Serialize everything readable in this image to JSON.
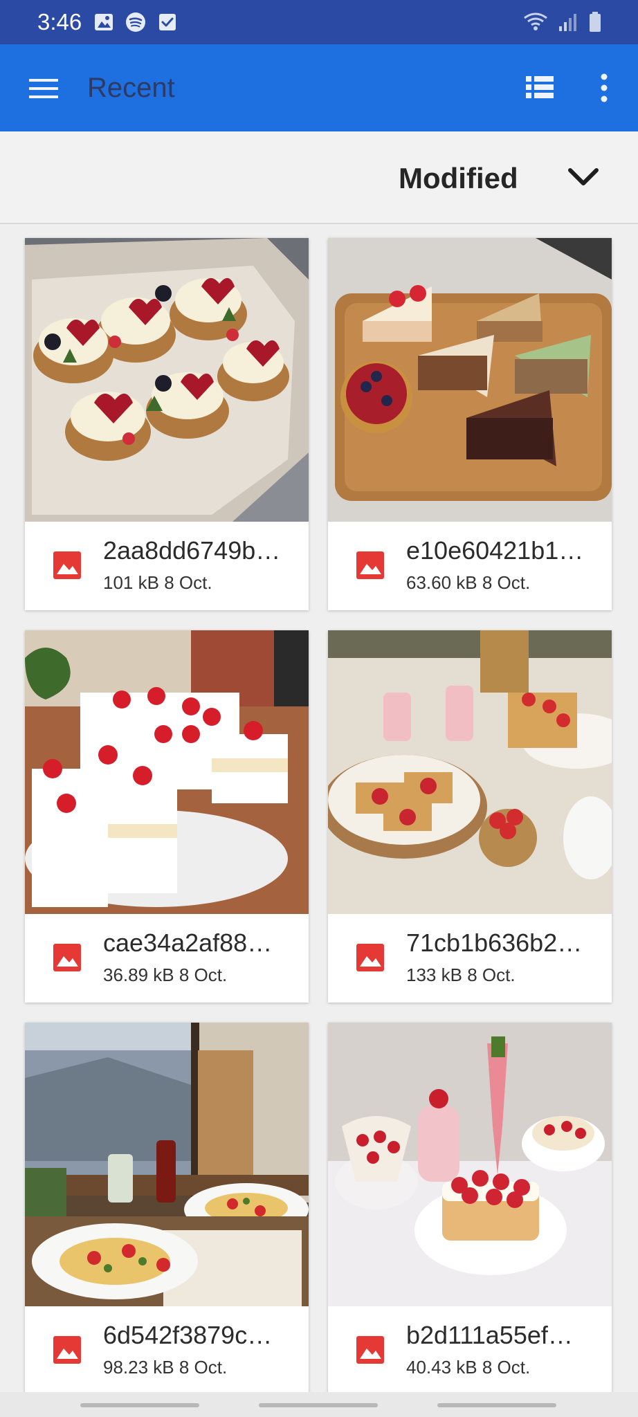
{
  "status_bar": {
    "time": "3:46",
    "left_icons": [
      "gallery-icon",
      "spotify-icon",
      "checkbox-icon"
    ],
    "right_icons": [
      "wifi-icon",
      "signal-icon",
      "battery-icon"
    ]
  },
  "app_bar": {
    "title": "Recent",
    "color": "#1e6fe0"
  },
  "sort": {
    "label": "Modified"
  },
  "files": [
    {
      "name": "2aa8dd6749b…",
      "size": "101 kB",
      "date": "8 Oct."
    },
    {
      "name": "e10e60421b1…",
      "size": "63.60 kB",
      "date": "8 Oct."
    },
    {
      "name": "cae34a2af88…",
      "size": "36.89 kB",
      "date": "8 Oct."
    },
    {
      "name": "71cb1b636b2…",
      "size": "133 kB",
      "date": "8 Oct."
    },
    {
      "name": "6d542f3879c…",
      "size": "98.23 kB",
      "date": "8 Oct."
    },
    {
      "name": "b2d111a55ef…",
      "size": "40.43 kB",
      "date": "8 Oct."
    }
  ],
  "colors": {
    "status_bar": "#2a4aa3",
    "image_icon": "#e53935"
  }
}
